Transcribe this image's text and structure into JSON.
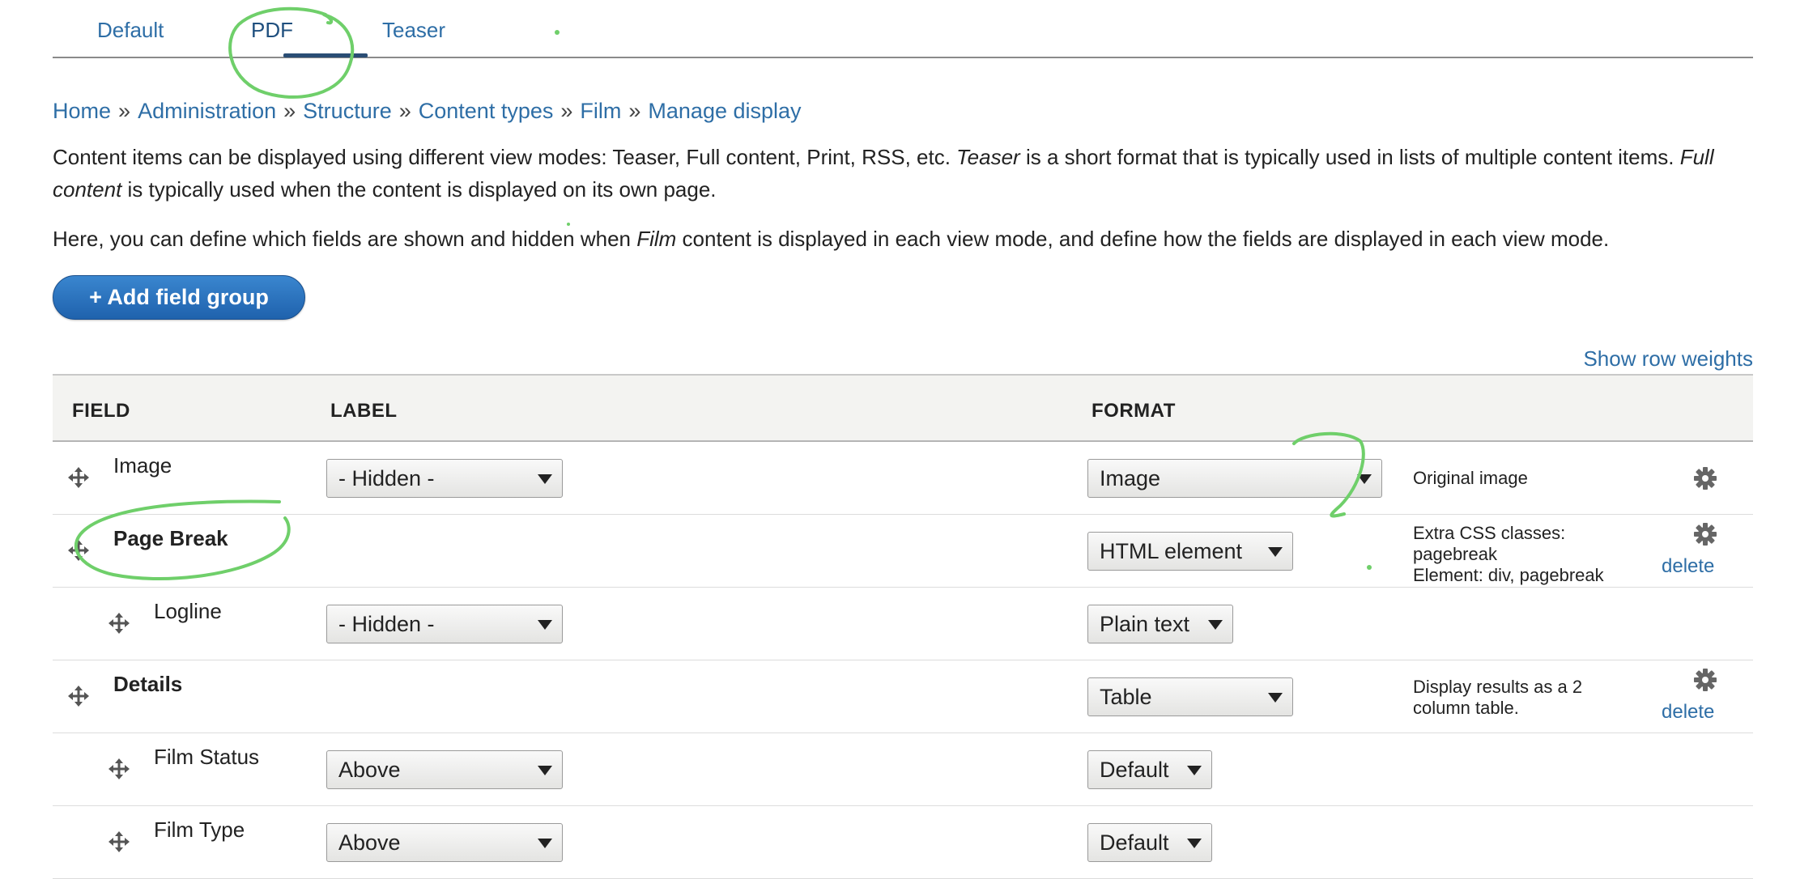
{
  "tabs": [
    {
      "label": "Default"
    },
    {
      "label": "PDF"
    },
    {
      "label": "Teaser"
    }
  ],
  "breadcrumb": [
    {
      "label": "Home"
    },
    {
      "label": "Administration"
    },
    {
      "label": "Structure"
    },
    {
      "label": "Content types"
    },
    {
      "label": "Film"
    },
    {
      "label": "Manage display"
    }
  ],
  "breadcrumb_sep": "»",
  "description": {
    "p1_a": "Content items can be displayed using different view modes: Teaser, Full content, Print, RSS, etc. ",
    "p1_em1": "Teaser",
    "p1_b": " is a short format that is typically used in lists of multiple content items. ",
    "p1_em2": "Full content",
    "p1_c": " is typically used when the content is displayed on its own page.",
    "p2_a": "Here, you can define which fields are shown and hidden when ",
    "p2_em": "Film",
    "p2_b": " content is displayed in each view mode, and define how the fields are displayed in each view mode."
  },
  "add_field_group_label": "+ Add field group",
  "show_row_weights_label": "Show row weights",
  "table": {
    "headers": {
      "field": "FIELD",
      "label": "LABEL",
      "format": "FORMAT"
    },
    "rows": [
      {
        "field": "Image",
        "label": "- Hidden -",
        "format": "Image",
        "summary": [
          "Original image"
        ],
        "gear": true,
        "delete": ""
      },
      {
        "field": "Page Break",
        "label": "",
        "format": "HTML element",
        "summary": [
          "Extra CSS classes:",
          "pagebreak",
          "Element: div, pagebreak"
        ],
        "gear": true,
        "delete": "delete"
      },
      {
        "field": "Logline",
        "label": "- Hidden -",
        "format": "Plain text",
        "summary": [],
        "gear": false,
        "delete": ""
      },
      {
        "field": "Details",
        "label": "",
        "format": "Table",
        "summary": [
          "Display results as a 2",
          "column table."
        ],
        "gear": true,
        "delete": "delete"
      },
      {
        "field": "Film Status",
        "label": "Above",
        "format": "Default",
        "summary": [],
        "gear": false,
        "delete": ""
      },
      {
        "field": "Film Type",
        "label": "Above",
        "format": "Default",
        "summary": [],
        "gear": false,
        "delete": ""
      }
    ]
  },
  "colors": {
    "link": "#2e6ea6",
    "button": "#2a72bf",
    "annotation": "#6fcf6a"
  },
  "icons": {
    "drag": "move-arrows-icon",
    "gear": "gear-icon"
  }
}
